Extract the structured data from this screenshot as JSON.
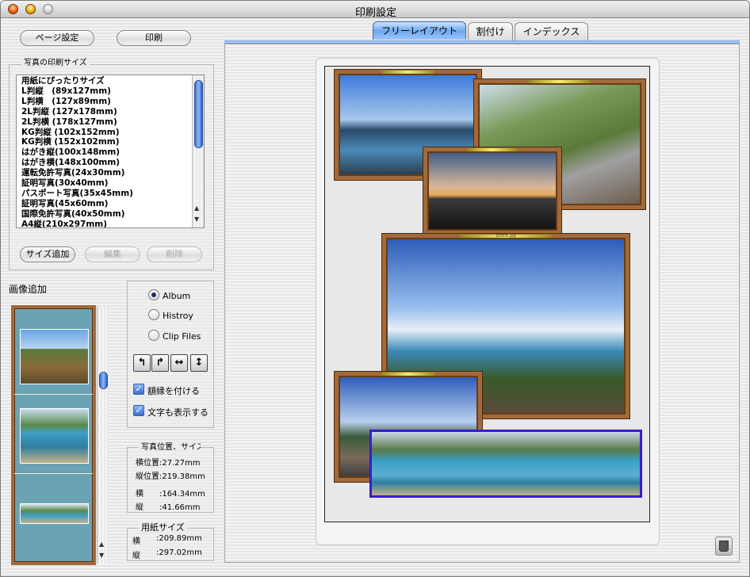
{
  "window": {
    "title": "印刷設定"
  },
  "toolbar": {
    "page_setup": "ページ設定",
    "print": "印刷"
  },
  "print_size": {
    "legend": "写真の印刷サイズ",
    "items": [
      "用紙にぴったりサイズ",
      "L判縦　(89x127mm)",
      "L判横　(127x89mm)",
      "2L判縦 (127x178mm)",
      "2L判横 (178x127mm)",
      "KG判縦 (102x152mm)",
      "KG判横 (152x102mm)",
      "はがき縦(100x148mm)",
      "はがき横(148x100mm)",
      "運転免許写真(24x30mm)",
      "証明写真(30x40mm)",
      "パスポート写真(35x45mm)",
      "証明写真(45x60mm)",
      "国際免許写真(40x50mm)",
      "A4縦(210x297mm)"
    ],
    "add_button": "サイズ追加",
    "edit_button": "編集",
    "delete_button": "削除"
  },
  "image_add": {
    "label": "画像追加"
  },
  "source": {
    "album": "Album",
    "history": "Histroy",
    "clip_files": "Clip Files",
    "selected": "Album"
  },
  "options": {
    "frame": "額縁を付ける",
    "show_text": "文字も表示する",
    "frame_checked": true,
    "text_checked": true
  },
  "position": {
    "legend": "写真位置、サイズ",
    "x": "横位置:27.27mm",
    "y": "縦位置:219.38mm",
    "width": "横　　:164.34mm",
    "height": "縦　　:41.66mm"
  },
  "paper": {
    "legend": "用紙サイズ",
    "width_label": "横",
    "width": ":209.89mm",
    "height_label": "縦",
    "height": ":297.02mm"
  },
  "tabs": [
    {
      "label": "フリーレイアウト",
      "selected": true
    },
    {
      "label": "割付け",
      "selected": false
    },
    {
      "label": "インデックス",
      "selected": false
    }
  ],
  "photos": [
    "00006.jpg",
    "00008.jpg"
  ],
  "colors": {
    "accent": "#3b6fd0",
    "frame": "#a26a3a",
    "selection": "#3a1ad0",
    "strip": "#6aa3b3"
  }
}
